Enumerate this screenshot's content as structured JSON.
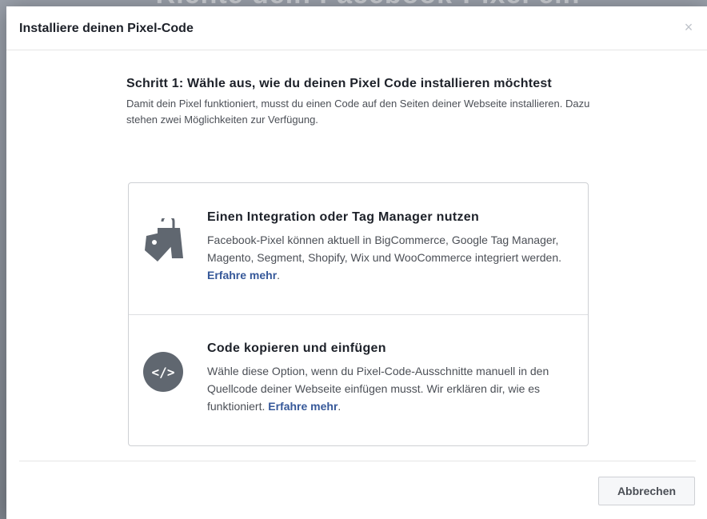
{
  "background": {
    "title": "Richte dein Facebook-Pixel ein"
  },
  "modal": {
    "title": "Installiere deinen Pixel-Code",
    "close_label": "×"
  },
  "step": {
    "title": "Schritt 1: Wähle aus, wie du deinen Pixel Code installieren möchtest",
    "description": "Damit dein Pixel funktioniert, musst du einen Code auf den Seiten deiner Webseite installieren. Dazu stehen zwei Möglichkeiten zur Verfügung."
  },
  "options": [
    {
      "title": "Einen Integration oder Tag Manager nutzen",
      "description": "Facebook-Pixel können aktuell in BigCommerce, Google Tag Manager, Magento, Segment, Shopify, Wix und WooCommerce integriert werden. ",
      "link": "Erfahre mehr",
      "suffix": ".",
      "icon": "shopping-bag-tag-icon"
    },
    {
      "title": "Code kopieren und einfügen",
      "description": "Wähle diese Option, wenn du Pixel-Code-Ausschnitte manuell in den Quellcode deiner Webseite einfügen musst. Wir erklären dir, wie es funktioniert. ",
      "link": "Erfahre mehr",
      "suffix": ".",
      "icon": "code-icon",
      "icon_text": "</>"
    }
  ],
  "footer": {
    "cancel_label": "Abbrechen"
  },
  "colors": {
    "link": "#365899",
    "icon": "#606770",
    "text": "#1d2129"
  }
}
